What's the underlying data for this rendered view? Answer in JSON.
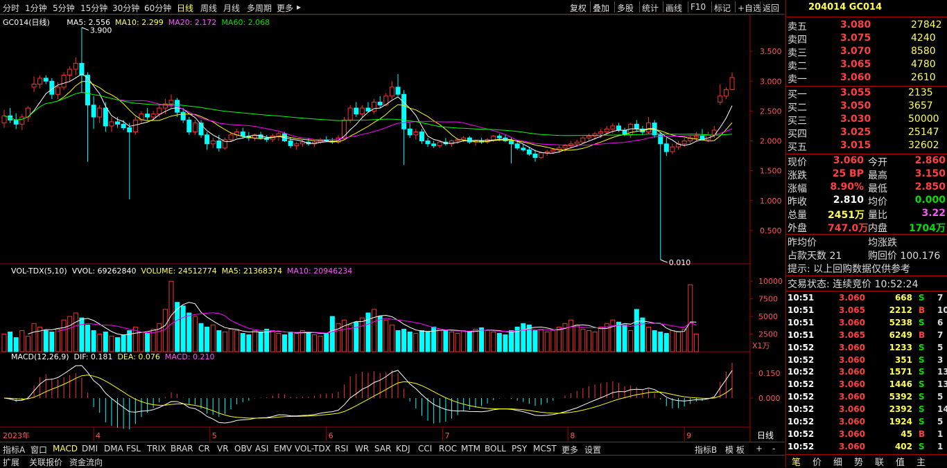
{
  "periods": [
    "分时",
    "1分钟",
    "5分钟",
    "15分钟",
    "30分钟",
    "60分钟",
    "日线",
    "周线",
    "月线",
    "多周期",
    "更多"
  ],
  "active_period": "日线",
  "tools": [
    "复权",
    "叠加",
    "多股",
    "统计",
    "画线",
    "F10",
    "标记",
    "+自选",
    "返回"
  ],
  "main": {
    "title": "GC014(日线)",
    "ma5": "MA5: 2.556",
    "ma10": "MA10: 2.299",
    "ma20": "MA20: 2.172",
    "ma60": "MA60: 2.068",
    "high_label": "3.900",
    "low_label": "0.010",
    "y_ticks": [
      "3.500",
      "3.000",
      "2.500",
      "2.000",
      "1.500",
      "1.000",
      "0.500"
    ]
  },
  "volume": {
    "title": "VOL-TDX(5,10)",
    "vvol": "VVOL: 69262840",
    "volume": "VOLUME: 24512774",
    "ma5": "MA5: 21368374",
    "ma10": "MA10: 20946234",
    "y_ticks": [
      "10000",
      "7500",
      "5000",
      "2500"
    ],
    "unit": "X1万"
  },
  "macd": {
    "title": "MACD(12,26,9)",
    "dif": "DIF: 0.181",
    "dea": "DEA: 0.076",
    "macd": "MACD: 0.210",
    "y_ticks": [
      "0.150",
      "0.000"
    ]
  },
  "x_axis": {
    "year": "2023年",
    "months": [
      "4",
      "5",
      "6",
      "7",
      "8",
      "9"
    ],
    "period_label": "日线"
  },
  "colors": {
    "up": "#ff3030",
    "down": "#00ffff",
    "ma5": "#ffffff",
    "ma10": "#ffff00",
    "ma20": "#ff00ff",
    "ma60": "#00ff00",
    "axis": "#a00000"
  },
  "chart_data": {
    "type": "candlestick",
    "title": "GC014(日线)",
    "candles": [
      {
        "o": 2.3,
        "h": 2.52,
        "l": 2.22,
        "c": 2.42
      },
      {
        "o": 2.42,
        "h": 2.55,
        "l": 2.3,
        "c": 2.35
      },
      {
        "o": 2.35,
        "h": 2.46,
        "l": 2.2,
        "c": 2.28
      },
      {
        "o": 2.28,
        "h": 2.45,
        "l": 2.18,
        "c": 2.4
      },
      {
        "o": 2.4,
        "h": 2.58,
        "l": 2.32,
        "c": 2.55
      },
      {
        "o": 2.9,
        "h": 3.08,
        "l": 2.82,
        "c": 2.95
      },
      {
        "o": 2.95,
        "h": 3.1,
        "l": 2.88,
        "c": 3.05
      },
      {
        "o": 3.05,
        "h": 3.1,
        "l": 2.95,
        "c": 3.0
      },
      {
        "o": 3.0,
        "h": 3.05,
        "l": 2.7,
        "c": 2.78
      },
      {
        "o": 2.78,
        "h": 2.98,
        "l": 2.7,
        "c": 2.9
      },
      {
        "o": 2.9,
        "h": 3.15,
        "l": 2.85,
        "c": 3.1
      },
      {
        "o": 3.1,
        "h": 3.25,
        "l": 3.0,
        "c": 3.2
      },
      {
        "o": 3.2,
        "h": 3.4,
        "l": 3.1,
        "c": 3.3
      },
      {
        "o": 3.3,
        "h": 3.9,
        "l": 2.8,
        "c": 3.1
      },
      {
        "o": 3.1,
        "h": 3.15,
        "l": 1.65,
        "c": 2.6
      },
      {
        "o": 2.6,
        "h": 2.75,
        "l": 2.2,
        "c": 2.4
      },
      {
        "o": 2.4,
        "h": 2.6,
        "l": 2.3,
        "c": 2.55
      },
      {
        "o": 2.55,
        "h": 2.65,
        "l": 2.15,
        "c": 2.25
      },
      {
        "o": 2.25,
        "h": 2.4,
        "l": 2.15,
        "c": 2.32
      },
      {
        "o": 2.32,
        "h": 2.4,
        "l": 2.22,
        "c": 2.28
      },
      {
        "o": 2.28,
        "h": 2.35,
        "l": 2.18,
        "c": 2.22
      },
      {
        "o": 2.22,
        "h": 2.3,
        "l": 1.02,
        "c": 2.15
      },
      {
        "o": 2.15,
        "h": 2.4,
        "l": 2.1,
        "c": 2.35
      },
      {
        "o": 2.35,
        "h": 2.5,
        "l": 2.3,
        "c": 2.45
      },
      {
        "o": 2.45,
        "h": 2.55,
        "l": 2.35,
        "c": 2.4
      },
      {
        "o": 2.4,
        "h": 2.5,
        "l": 2.35,
        "c": 2.45
      },
      {
        "o": 2.45,
        "h": 2.6,
        "l": 2.4,
        "c": 2.55
      },
      {
        "o": 2.55,
        "h": 2.7,
        "l": 2.45,
        "c": 2.62
      },
      {
        "o": 2.62,
        "h": 2.78,
        "l": 2.55,
        "c": 2.68
      },
      {
        "o": 2.68,
        "h": 2.72,
        "l": 2.4,
        "c": 2.48
      },
      {
        "o": 2.48,
        "h": 2.55,
        "l": 2.3,
        "c": 2.35
      },
      {
        "o": 2.35,
        "h": 2.4,
        "l": 2.1,
        "c": 2.15
      },
      {
        "o": 2.15,
        "h": 2.35,
        "l": 2.1,
        "c": 2.3
      },
      {
        "o": 2.3,
        "h": 2.35,
        "l": 2.05,
        "c": 2.1
      },
      {
        "o": 2.1,
        "h": 2.15,
        "l": 1.85,
        "c": 1.95
      },
      {
        "o": 1.95,
        "h": 2.05,
        "l": 1.88,
        "c": 2.0
      },
      {
        "o": 2.0,
        "h": 2.1,
        "l": 1.82,
        "c": 1.88
      },
      {
        "o": 1.88,
        "h": 2.05,
        "l": 1.85,
        "c": 2.02
      },
      {
        "o": 2.02,
        "h": 2.15,
        "l": 1.98,
        "c": 2.1
      },
      {
        "o": 2.1,
        "h": 2.2,
        "l": 2.05,
        "c": 2.15
      },
      {
        "o": 2.15,
        "h": 2.22,
        "l": 2.05,
        "c": 2.08
      },
      {
        "o": 2.08,
        "h": 2.15,
        "l": 2.0,
        "c": 2.05
      },
      {
        "o": 2.05,
        "h": 2.12,
        "l": 2.0,
        "c": 2.1
      },
      {
        "o": 2.1,
        "h": 2.15,
        "l": 2.02,
        "c": 2.05
      },
      {
        "o": 2.05,
        "h": 2.1,
        "l": 1.98,
        "c": 2.02
      },
      {
        "o": 2.02,
        "h": 2.12,
        "l": 1.98,
        "c": 2.08
      },
      {
        "o": 2.08,
        "h": 2.15,
        "l": 2.0,
        "c": 2.12
      },
      {
        "o": 2.12,
        "h": 2.15,
        "l": 1.98,
        "c": 2.0
      },
      {
        "o": 2.0,
        "h": 2.05,
        "l": 1.88,
        "c": 1.92
      },
      {
        "o": 1.92,
        "h": 1.98,
        "l": 1.85,
        "c": 1.95
      },
      {
        "o": 1.95,
        "h": 2.02,
        "l": 1.9,
        "c": 1.98
      },
      {
        "o": 1.98,
        "h": 2.05,
        "l": 1.92,
        "c": 1.95
      },
      {
        "o": 1.95,
        "h": 2.0,
        "l": 1.9,
        "c": 1.98
      },
      {
        "o": 1.98,
        "h": 2.05,
        "l": 1.95,
        "c": 2.02
      },
      {
        "o": 2.02,
        "h": 2.08,
        "l": 1.98,
        "c": 2.0
      },
      {
        "o": 2.0,
        "h": 2.05,
        "l": 1.95,
        "c": 1.98
      },
      {
        "o": 1.98,
        "h": 2.1,
        "l": 1.95,
        "c": 2.05
      },
      {
        "o": 2.05,
        "h": 2.4,
        "l": 2.02,
        "c": 2.35
      },
      {
        "o": 2.35,
        "h": 2.6,
        "l": 2.3,
        "c": 2.55
      },
      {
        "o": 2.55,
        "h": 2.65,
        "l": 2.4,
        "c": 2.45
      },
      {
        "o": 2.45,
        "h": 2.6,
        "l": 2.4,
        "c": 2.55
      },
      {
        "o": 2.55,
        "h": 2.65,
        "l": 2.48,
        "c": 2.5
      },
      {
        "o": 2.5,
        "h": 2.7,
        "l": 2.45,
        "c": 2.65
      },
      {
        "o": 2.65,
        "h": 2.75,
        "l": 2.55,
        "c": 2.6
      },
      {
        "o": 2.6,
        "h": 2.8,
        "l": 2.58,
        "c": 2.75
      },
      {
        "o": 2.75,
        "h": 3.0,
        "l": 2.7,
        "c": 2.9
      },
      {
        "o": 2.9,
        "h": 3.12,
        "l": 2.75,
        "c": 2.78
      },
      {
        "o": 2.78,
        "h": 2.85,
        "l": 1.6,
        "c": 2.2
      },
      {
        "o": 2.2,
        "h": 2.3,
        "l": 2.05,
        "c": 2.1
      },
      {
        "o": 2.1,
        "h": 2.2,
        "l": 2.02,
        "c": 2.15
      },
      {
        "o": 2.15,
        "h": 2.2,
        "l": 1.95,
        "c": 2.0
      },
      {
        "o": 2.0,
        "h": 2.05,
        "l": 1.9,
        "c": 1.95
      },
      {
        "o": 1.95,
        "h": 2.0,
        "l": 1.88,
        "c": 1.92
      },
      {
        "o": 1.92,
        "h": 2.0,
        "l": 1.88,
        "c": 1.98
      },
      {
        "o": 1.98,
        "h": 2.05,
        "l": 1.92,
        "c": 1.95
      },
      {
        "o": 1.95,
        "h": 2.02,
        "l": 1.9,
        "c": 2.0
      },
      {
        "o": 2.0,
        "h": 2.05,
        "l": 1.95,
        "c": 2.02
      },
      {
        "o": 2.02,
        "h": 2.08,
        "l": 1.98,
        "c": 2.05
      },
      {
        "o": 2.05,
        "h": 2.08,
        "l": 1.95,
        "c": 1.98
      },
      {
        "o": 1.98,
        "h": 2.02,
        "l": 1.92,
        "c": 2.0
      },
      {
        "o": 2.0,
        "h": 2.05,
        "l": 1.95,
        "c": 1.98
      },
      {
        "o": 1.98,
        "h": 2.05,
        "l": 1.95,
        "c": 2.02
      },
      {
        "o": 2.02,
        "h": 2.1,
        "l": 1.98,
        "c": 2.08
      },
      {
        "o": 2.08,
        "h": 2.12,
        "l": 2.0,
        "c": 2.05
      },
      {
        "o": 2.05,
        "h": 2.1,
        "l": 1.98,
        "c": 2.0
      },
      {
        "o": 2.0,
        "h": 2.05,
        "l": 1.62,
        "c": 1.95
      },
      {
        "o": 1.95,
        "h": 2.0,
        "l": 1.85,
        "c": 1.88
      },
      {
        "o": 1.88,
        "h": 1.95,
        "l": 1.82,
        "c": 1.85
      },
      {
        "o": 1.85,
        "h": 1.9,
        "l": 1.75,
        "c": 1.78
      },
      {
        "o": 1.78,
        "h": 1.85,
        "l": 1.65,
        "c": 1.72
      },
      {
        "o": 1.72,
        "h": 1.82,
        "l": 1.7,
        "c": 1.8
      },
      {
        "o": 1.8,
        "h": 1.85,
        "l": 1.75,
        "c": 1.82
      },
      {
        "o": 1.82,
        "h": 1.88,
        "l": 1.78,
        "c": 1.85
      },
      {
        "o": 1.85,
        "h": 1.92,
        "l": 1.8,
        "c": 1.88
      },
      {
        "o": 1.88,
        "h": 1.95,
        "l": 1.82,
        "c": 1.92
      },
      {
        "o": 1.92,
        "h": 2.0,
        "l": 1.88,
        "c": 1.95
      },
      {
        "o": 1.95,
        "h": 2.02,
        "l": 1.9,
        "c": 1.98
      },
      {
        "o": 1.98,
        "h": 2.08,
        "l": 1.95,
        "c": 2.05
      },
      {
        "o": 2.05,
        "h": 2.12,
        "l": 2.0,
        "c": 2.08
      },
      {
        "o": 2.08,
        "h": 2.15,
        "l": 2.02,
        "c": 2.12
      },
      {
        "o": 2.12,
        "h": 2.2,
        "l": 2.05,
        "c": 2.15
      },
      {
        "o": 2.15,
        "h": 2.25,
        "l": 2.1,
        "c": 2.2
      },
      {
        "o": 2.2,
        "h": 2.3,
        "l": 2.12,
        "c": 2.25
      },
      {
        "o": 2.25,
        "h": 2.3,
        "l": 2.15,
        "c": 2.18
      },
      {
        "o": 2.18,
        "h": 2.22,
        "l": 2.08,
        "c": 2.1
      },
      {
        "o": 2.1,
        "h": 2.3,
        "l": 2.05,
        "c": 2.28
      },
      {
        "o": 2.28,
        "h": 2.35,
        "l": 2.15,
        "c": 2.2
      },
      {
        "o": 2.2,
        "h": 2.25,
        "l": 2.1,
        "c": 2.15
      },
      {
        "o": 2.15,
        "h": 2.4,
        "l": 2.12,
        "c": 2.3
      },
      {
        "o": 2.3,
        "h": 2.35,
        "l": 2.05,
        "c": 2.1
      },
      {
        "o": 2.1,
        "h": 2.15,
        "l": 0.01,
        "c": 1.95
      },
      {
        "o": 1.95,
        "h": 2.05,
        "l": 1.75,
        "c": 1.82
      },
      {
        "o": 1.82,
        "h": 1.95,
        "l": 1.78,
        "c": 1.9
      },
      {
        "o": 1.9,
        "h": 2.0,
        "l": 1.85,
        "c": 1.95
      },
      {
        "o": 1.95,
        "h": 2.05,
        "l": 1.9,
        "c": 2.0
      },
      {
        "o": 2.0,
        "h": 2.1,
        "l": 1.95,
        "c": 2.05
      },
      {
        "o": 2.05,
        "h": 2.15,
        "l": 1.98,
        "c": 2.08
      },
      {
        "o": 2.08,
        "h": 2.2,
        "l": 2.0,
        "c": 2.02
      },
      {
        "o": 2.02,
        "h": 2.15,
        "l": 1.98,
        "c": 2.1
      },
      {
        "o": 2.1,
        "h": 2.25,
        "l": 2.05,
        "c": 2.18
      },
      {
        "o": 2.65,
        "h": 2.95,
        "l": 2.6,
        "c": 2.75
      },
      {
        "o": 2.75,
        "h": 2.9,
        "l": 2.7,
        "c": 2.86
      },
      {
        "o": 2.86,
        "h": 3.15,
        "l": 2.85,
        "c": 3.06
      }
    ],
    "volumes": [
      25,
      28,
      20,
      30,
      22,
      40,
      35,
      30,
      28,
      32,
      45,
      50,
      55,
      48,
      38,
      30,
      25,
      28,
      22,
      20,
      24,
      30,
      35,
      28,
      26,
      32,
      40,
      60,
      100,
      70,
      65,
      55,
      50,
      40,
      35,
      38,
      30,
      28,
      32,
      30,
      26,
      24,
      30,
      28,
      32,
      30,
      26,
      24,
      28,
      26,
      30,
      28,
      24,
      22,
      26,
      50,
      40,
      45,
      38,
      42,
      48,
      55,
      60,
      50,
      45,
      38,
      30,
      32,
      28,
      26,
      30,
      28,
      35,
      32,
      30,
      28,
      26,
      30,
      28,
      32,
      34,
      30,
      28,
      26,
      24,
      30,
      35,
      40,
      38,
      30,
      32,
      28,
      30,
      35,
      40,
      45,
      38,
      32,
      30,
      28,
      35,
      40,
      45,
      42,
      38,
      30,
      60,
      48,
      35,
      30,
      28,
      26,
      30,
      28,
      32,
      95,
      25
    ],
    "volume_ylim": [
      0,
      11000
    ],
    "macd": {
      "dif": "0.181",
      "dea": "0.076",
      "macd": "0.210"
    },
    "ylim": [
      0,
      4.0
    ]
  },
  "quote": {
    "title": "204014 GC014",
    "asks": [
      {
        "label": "卖五",
        "price": "3.080",
        "vol": "27842"
      },
      {
        "label": "卖四",
        "price": "3.075",
        "vol": "4240"
      },
      {
        "label": "卖三",
        "price": "3.070",
        "vol": "8580"
      },
      {
        "label": "卖二",
        "price": "3.065",
        "vol": "4780"
      },
      {
        "label": "卖一",
        "price": "3.060",
        "vol": "2610"
      }
    ],
    "bids": [
      {
        "label": "买一",
        "price": "3.055",
        "vol": "2135"
      },
      {
        "label": "买二",
        "price": "3.050",
        "vol": "3657"
      },
      {
        "label": "买三",
        "price": "3.030",
        "vol": "50000"
      },
      {
        "label": "买四",
        "price": "3.025",
        "vol": "25147"
      },
      {
        "label": "买五",
        "price": "3.015",
        "vol": "32602"
      }
    ],
    "stats": [
      {
        "l1": "现价",
        "v1": "3.060",
        "l2": "今开",
        "v2": "2.860"
      },
      {
        "l1": "涨跌",
        "v1": "25 BP",
        "l2": "最高",
        "v2": "3.150"
      },
      {
        "l1": "涨幅",
        "v1": "8.90%",
        "l2": "最低",
        "v2": "2.850"
      },
      {
        "l1": "昨收",
        "v1": "2.810",
        "l2": "均价",
        "v2": "0.000"
      },
      {
        "l1": "总量",
        "v1": "2451万",
        "l2": "量比",
        "v2": "3.22"
      },
      {
        "l1": "外盘",
        "v1": "747.0万",
        "l2": "内盘",
        "v2": "1704万"
      }
    ],
    "avg_price_label": "昨均价",
    "avg_change_label": "均涨跌",
    "days_label": "占款天数 21",
    "repo_label": "购回价 100.176",
    "hint": "提示: 以上回购数据仅供参考",
    "status": "交易状态: 连续竞价  10:52:24",
    "ticks": [
      {
        "t": "10:51",
        "p": "3.060",
        "v": "668",
        "d": "S",
        "n": "7"
      },
      {
        "t": "10:51",
        "p": "3.065",
        "v": "2212",
        "d": "B",
        "n": "10"
      },
      {
        "t": "10:51",
        "p": "3.060",
        "v": "5238",
        "d": "S",
        "n": "6"
      },
      {
        "t": "10:51",
        "p": "3.065",
        "v": "6249",
        "d": "B",
        "n": "7"
      },
      {
        "t": "10:52",
        "p": "3.060",
        "v": "1233",
        "d": "S",
        "n": "5"
      },
      {
        "t": "10:52",
        "p": "3.060",
        "v": "351",
        "d": "S",
        "n": "3"
      },
      {
        "t": "10:52",
        "p": "3.060",
        "v": "1571",
        "d": "S",
        "n": "13"
      },
      {
        "t": "10:52",
        "p": "3.060",
        "v": "1446",
        "d": "S",
        "n": "13"
      },
      {
        "t": "10:52",
        "p": "3.060",
        "v": "5392",
        "d": "S",
        "n": "5"
      },
      {
        "t": "10:52",
        "p": "3.060",
        "v": "2392",
        "d": "S",
        "n": "14"
      },
      {
        "t": "10:52",
        "p": "3.060",
        "v": "1924",
        "d": "S",
        "n": "5"
      },
      {
        "t": "10:52",
        "p": "3.060",
        "v": "45",
        "d": "B",
        "n": "1"
      },
      {
        "t": "10:52",
        "p": "3.060",
        "v": "402",
        "d": "S",
        "n": "1"
      }
    ],
    "bottom_tabs": [
      "笔",
      "价",
      "细",
      "势",
      "联",
      "值",
      "主"
    ]
  },
  "indicator_tabs": [
    "指标A",
    "窗口",
    "MACD",
    "DMI",
    "DMA",
    "FSL",
    "TRIX",
    "BRAR",
    "CR",
    "VR",
    "OBV",
    "ASI",
    "EMV",
    "VOL-TDX",
    "RSI",
    "WR",
    "SAR",
    "KDJ",
    "CCI",
    "ROC",
    "MTM",
    "BOLL",
    "PSY",
    "MCST",
    "更多",
    "设置"
  ],
  "active_indicator": "MACD",
  "indicator_right": [
    "指标B",
    "模 板",
    "+",
    "-"
  ],
  "bottom_tabs": [
    "扩展",
    "关联报价",
    "资金流向"
  ]
}
